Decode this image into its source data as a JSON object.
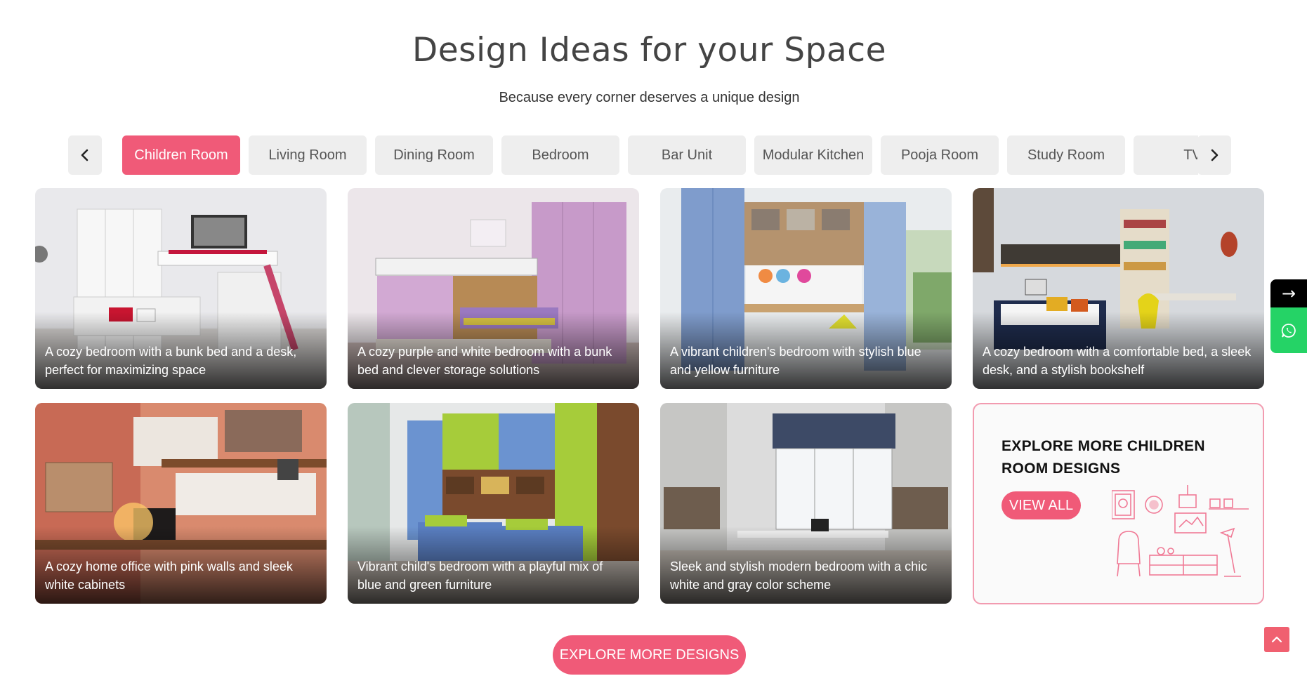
{
  "header": {
    "title": "Design Ideas for your Space",
    "subtitle": "Because every corner deserves a unique design"
  },
  "tabs": [
    {
      "label": "Children Room",
      "active": true
    },
    {
      "label": "Living Room",
      "active": false
    },
    {
      "label": "Dining Room",
      "active": false
    },
    {
      "label": "Bedroom",
      "active": false
    },
    {
      "label": "Bar Unit",
      "active": false
    },
    {
      "label": "Modular Kitchen",
      "active": false
    },
    {
      "label": "Pooja Room",
      "active": false
    },
    {
      "label": "Study Room",
      "active": false
    },
    {
      "label": "TV",
      "active": false
    }
  ],
  "nav_icons": {
    "prev": "chevron-left-icon",
    "next": "chevron-right-icon"
  },
  "cards": [
    {
      "caption": "A cozy bedroom with a bunk bed and a desk, perfect for maximizing space"
    },
    {
      "caption": "A cozy purple and white bedroom with a bunk bed and clever storage solutions"
    },
    {
      "caption": "A vibrant children's bedroom with stylish blue and yellow furniture"
    },
    {
      "caption": "A cozy bedroom with a comfortable bed, a sleek desk, and a stylish bookshelf"
    },
    {
      "caption": "A cozy home office with pink walls and sleek white cabinets"
    },
    {
      "caption": "Vibrant child's bedroom with a playful mix of blue and green furniture"
    },
    {
      "caption": "Sleek and stylish modern bedroom with a chic white and gray color scheme"
    }
  ],
  "explore_card": {
    "title": "EXPLORE MORE CHILDREN ROOM DESIGNS",
    "button": "VIEW ALL",
    "icon": "room-sketch-icon"
  },
  "explore_more_button": "EXPLORE MORE DESIGNS",
  "side_dock": {
    "arrow_icon": "arrow-right-icon",
    "arrow": "→",
    "whatsapp_icon": "whatsapp-icon"
  },
  "back_to_top_icon": "chevron-up-icon",
  "colors": {
    "accent": "#f05a78",
    "tab_bg": "#eeeeee",
    "whatsapp": "#25d366"
  }
}
